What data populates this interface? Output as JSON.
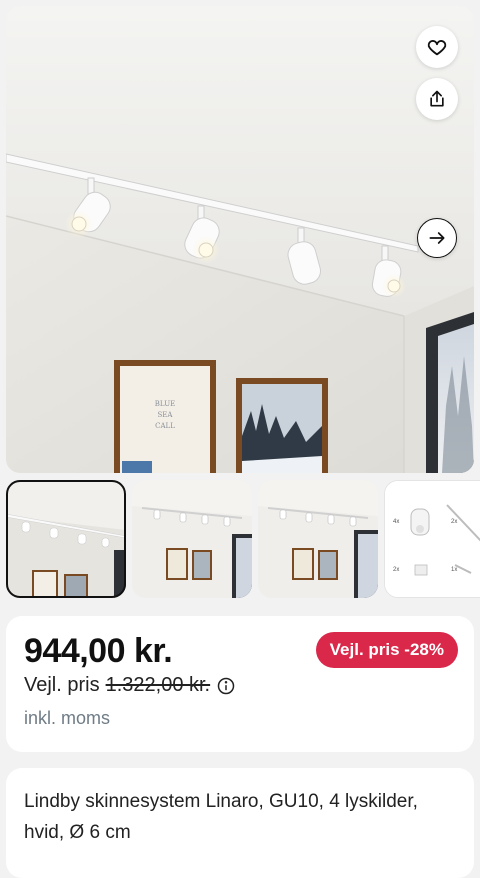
{
  "gallery": {
    "actions": {
      "favorite": "heart-icon",
      "share": "share-icon",
      "next": "arrow-right-icon"
    },
    "hero_poster_text": "BLUE\nSEA\nCALL",
    "thumbnails": [
      {
        "label": "Track system with spotlights - close view",
        "selected": true
      },
      {
        "label": "Room view with framed pictures",
        "selected": false
      },
      {
        "label": "Room view with window",
        "selected": false
      },
      {
        "label": "Included parts",
        "selected": false
      }
    ],
    "parts_labels": [
      "4x",
      "2x",
      "2x",
      "1x"
    ]
  },
  "pricing": {
    "price": "944,00 kr.",
    "discount_badge": "Vejl. pris -28%",
    "rrp_label": "Vejl. pris",
    "rrp_value": "1.322,00 kr.",
    "vat_note": "inkl. moms"
  },
  "product": {
    "title": "Lindby skinnesystem Linaro, GU10, 4 lyskilder, hvid, Ø 6 cm"
  },
  "colors": {
    "badge": "#d9284a",
    "muted_text": "#6f7c86"
  }
}
